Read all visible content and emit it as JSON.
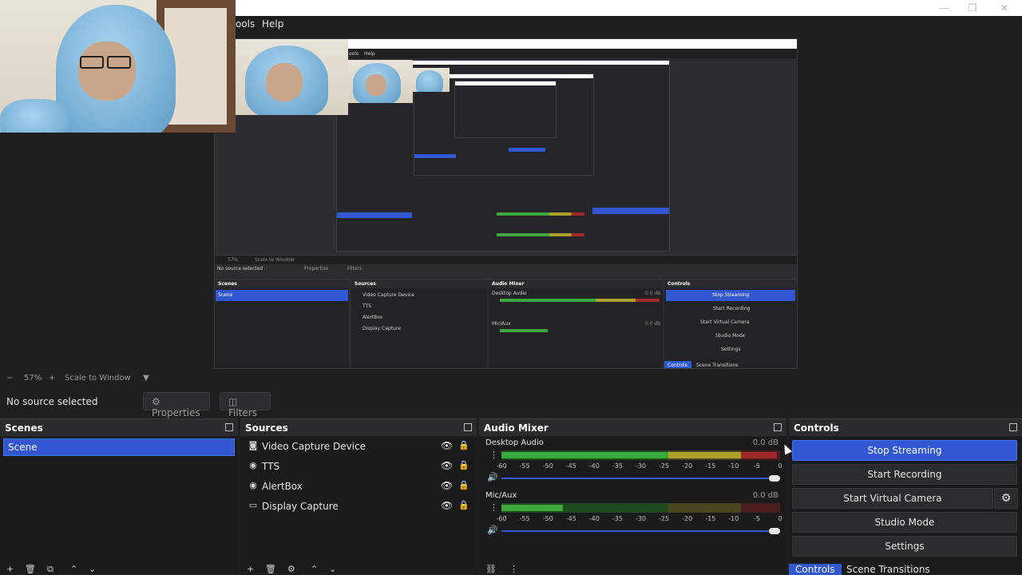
{
  "menu": {
    "tools_label": "ools",
    "help_label": "Help"
  },
  "window": {
    "minimize": "—",
    "maximize": "❐",
    "close": "✕"
  },
  "preview": {
    "nested_text": {
      "no_source": "No source selected",
      "properties": "Properties",
      "filters": "Filters",
      "scenes": "Scenes",
      "sources": "Sources",
      "audio_mixer": "Audio Mixer",
      "controls": "Controls",
      "scene": "Scene",
      "video_capture": "Video Capture Device",
      "tts": "TTS",
      "alertbox": "AlertBox",
      "display_capture": "Display Capture",
      "desktop_audio": "Desktop Audio",
      "mic_aux": "Mic/Aux",
      "db": "0.0 dB",
      "stop_streaming": "Stop Streaming",
      "start_recording": "Start Recording",
      "start_virtual_camera": "Start Virtual Camera",
      "studio_mode": "Studio Mode",
      "settings": "Settings",
      "controls_tab": "Controls",
      "scene_transitions": "Scene Transitions",
      "zoom": "57%",
      "scale": "Scale to Window",
      "tools": "ools",
      "help": "Help"
    }
  },
  "zoom": {
    "minus": "−",
    "value": "57%",
    "plus": "+",
    "scale": "Scale to Window",
    "dropdown": "▼"
  },
  "source_bar": {
    "no_source": "No source selected",
    "properties_icon": "⚙",
    "properties": "Properties",
    "filters_icon": "◫",
    "filters": "Filters"
  },
  "scenes": {
    "title": "Scenes",
    "items": [
      "Scene"
    ]
  },
  "sources": {
    "title": "Sources",
    "items": [
      {
        "icon": "camera",
        "glyph": "◙",
        "label": "Video Capture Device"
      },
      {
        "icon": "globe",
        "glyph": "◉",
        "label": "TTS"
      },
      {
        "icon": "globe",
        "glyph": "◉",
        "label": "AlertBox"
      },
      {
        "icon": "monitor",
        "glyph": "▭",
        "label": "Display Capture"
      }
    ],
    "eye_glyph": "👁",
    "lock_glyph": "🔒"
  },
  "mixer": {
    "title": "Audio Mixer",
    "channels": [
      {
        "name": "Desktop Audio",
        "db": "0.0 dB",
        "level": 0.99,
        "volume": 1.0
      },
      {
        "name": "Mic/Aux",
        "db": "0.0 dB",
        "level": 0.22,
        "volume": 1.0
      }
    ],
    "ticks": [
      "-60",
      "-55",
      "-50",
      "-45",
      "-40",
      "-35",
      "-30",
      "-25",
      "-20",
      "-15",
      "-10",
      "-5",
      "0"
    ],
    "colors": {
      "green": "#3aa83a",
      "yellow": "#a8a22a",
      "red": "#a02a2a",
      "green_dim": "#1e4a1e",
      "yellow_dim": "#4a4720",
      "red_dim": "#4a1e1e"
    }
  },
  "controls": {
    "title": "Controls",
    "stop_streaming": "Stop Streaming",
    "start_recording": "Start Recording",
    "start_virtual_camera": "Start Virtual Camera",
    "studio_mode": "Studio Mode",
    "settings": "Settings",
    "gear": "⚙",
    "tabs": [
      "Controls",
      "Scene Transitions"
    ],
    "accent": "#3158d0"
  },
  "toolbar_glyphs": {
    "add": "+",
    "remove": "🗑",
    "filter": "⧉",
    "up": "⌃",
    "down": "⌄",
    "gear": "⚙",
    "menu": "⋮",
    "link": "⛓"
  }
}
